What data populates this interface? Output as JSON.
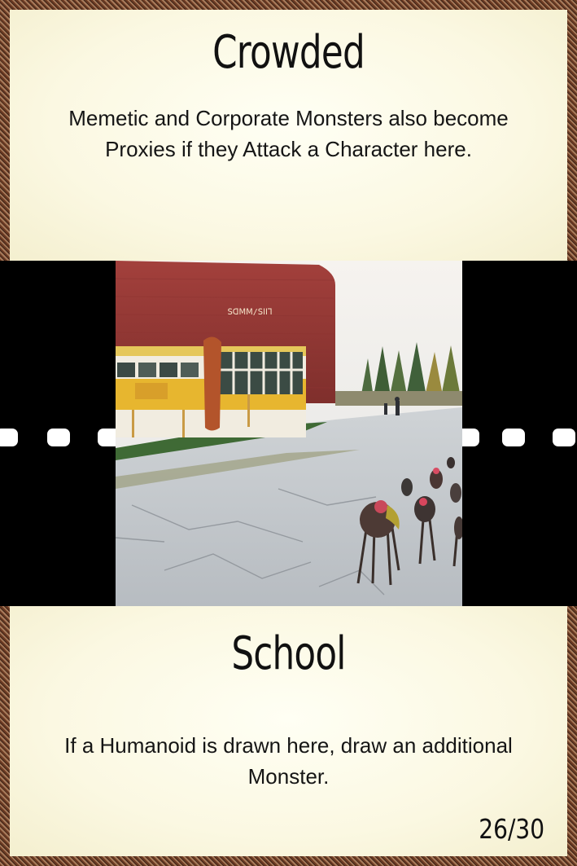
{
  "card": {
    "event_title": "Crowded",
    "event_rule": "Memetic and Corporate Monsters also become Proxies if they Attack a Character here.",
    "location_title": "School",
    "location_rule": "If a Humanoid is drawn here, draw an additional Monster.",
    "counter": "26/30"
  },
  "illustration": {
    "subject": "school-building-with-monsters",
    "sign_text": "ꓢꓷꓟꓟ/ꓢꓲꓲꓶ"
  },
  "colors": {
    "panel": "#fbf8e2",
    "border": "#6b3a22",
    "band": "#000000",
    "text": "#111111"
  }
}
